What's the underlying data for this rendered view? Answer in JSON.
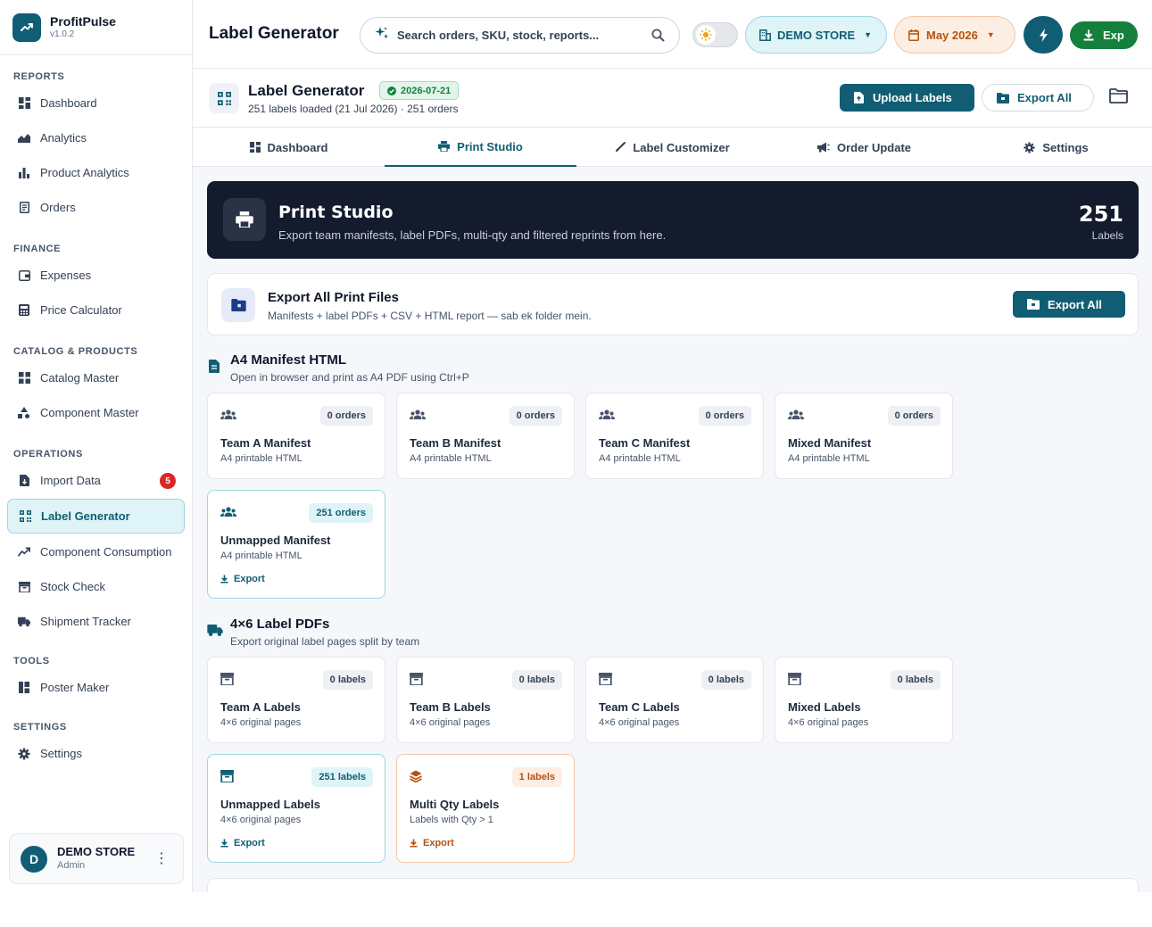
{
  "brand": {
    "name": "ProfitPulse",
    "version": "v1.0.2"
  },
  "sidebar": {
    "sections": [
      {
        "title": "REPORTS",
        "items": [
          {
            "label": "Dashboard",
            "icon": "grid-icon"
          },
          {
            "label": "Analytics",
            "icon": "chart-area-icon"
          },
          {
            "label": "Product Analytics",
            "icon": "bar-chart-icon"
          },
          {
            "label": "Orders",
            "icon": "document-icon"
          }
        ]
      },
      {
        "title": "FINANCE",
        "items": [
          {
            "label": "Expenses",
            "icon": "wallet-icon"
          },
          {
            "label": "Price Calculator",
            "icon": "calculator-icon"
          }
        ]
      },
      {
        "title": "CATALOG & PRODUCTS",
        "items": [
          {
            "label": "Catalog Master",
            "icon": "grid-icon"
          },
          {
            "label": "Component Master",
            "icon": "shapes-icon"
          }
        ]
      },
      {
        "title": "OPERATIONS",
        "items": [
          {
            "label": "Import Data",
            "icon": "file-import-icon",
            "badge": "5"
          },
          {
            "label": "Label Generator",
            "icon": "qrcode-icon",
            "active": true
          },
          {
            "label": "Component Consumption",
            "icon": "trend-icon"
          },
          {
            "label": "Stock Check",
            "icon": "box-icon"
          },
          {
            "label": "Shipment Tracker",
            "icon": "truck-icon"
          }
        ]
      },
      {
        "title": "TOOLS",
        "items": [
          {
            "label": "Poster Maker",
            "icon": "layout-icon"
          }
        ]
      },
      {
        "title": "SETTINGS",
        "items": [
          {
            "label": "Settings",
            "icon": "gear-icon"
          }
        ]
      }
    ],
    "user": {
      "initial": "D",
      "name": "DEMO STORE",
      "role": "Admin"
    }
  },
  "topbar": {
    "title": "Label Generator",
    "search_placeholder": "Search orders, SKU, stock, reports...",
    "store": "DEMO STORE",
    "month": "May 2026",
    "export_label": "Exp"
  },
  "page": {
    "title": "Label Generator",
    "date_chip": "2026-07-21",
    "subtitle": "251 labels loaded (21 Jul 2026) · 251 orders",
    "upload_label": "Upload Labels",
    "export_all_label": "Export All"
  },
  "tabs": [
    {
      "label": "Dashboard",
      "icon": "grid-icon"
    },
    {
      "label": "Print Studio",
      "icon": "printer-icon",
      "active": true
    },
    {
      "label": "Label Customizer",
      "icon": "brush-icon"
    },
    {
      "label": "Order Update",
      "icon": "megaphone-icon"
    },
    {
      "label": "Settings",
      "icon": "gear-icon"
    }
  ],
  "hero": {
    "title": "Print Studio",
    "subtitle": "Export team manifests, label PDFs, multi-qty and filtered reprints from here.",
    "count": "251",
    "count_label": "Labels"
  },
  "export_card": {
    "title": "Export All Print Files",
    "subtitle": "Manifests + label PDFs + CSV + HTML report — sab ek folder mein.",
    "button": "Export All"
  },
  "manifest_section": {
    "title": "A4 Manifest HTML",
    "subtitle": "Open in browser and print as A4 PDF using Ctrl+P",
    "cards": [
      {
        "title": "Team A Manifest",
        "sub": "A4 printable HTML",
        "badge": "0 orders"
      },
      {
        "title": "Team B Manifest",
        "sub": "A4 printable HTML",
        "badge": "0 orders"
      },
      {
        "title": "Team C Manifest",
        "sub": "A4 printable HTML",
        "badge": "0 orders"
      },
      {
        "title": "Mixed Manifest",
        "sub": "A4 printable HTML",
        "badge": "0 orders"
      },
      {
        "title": "Unmapped Manifest",
        "sub": "A4 printable HTML",
        "badge": "251 orders",
        "action": "Export"
      }
    ]
  },
  "labels_section": {
    "title": "4×6 Label PDFs",
    "subtitle": "Export original label pages split by team",
    "cards": [
      {
        "title": "Team A Labels",
        "sub": "4×6 original pages",
        "badge": "0 labels"
      },
      {
        "title": "Team B Labels",
        "sub": "4×6 original pages",
        "badge": "0 labels"
      },
      {
        "title": "Team C Labels",
        "sub": "4×6 original pages",
        "badge": "0 labels"
      },
      {
        "title": "Mixed Labels",
        "sub": "4×6 original pages",
        "badge": "0 labels"
      },
      {
        "title": "Unmapped Labels",
        "sub": "4×6 original pages",
        "badge": "251 labels",
        "action": "Export"
      },
      {
        "title": "Multi Qty Labels",
        "sub": "Labels with Qty > 1",
        "badge": "1 labels",
        "action": "Export"
      }
    ]
  },
  "colors": {
    "accent": "#115e74",
    "success": "#15803d",
    "warning": "#b4530f",
    "hero_bg": "#141b2d",
    "danger": "#dc2626"
  }
}
